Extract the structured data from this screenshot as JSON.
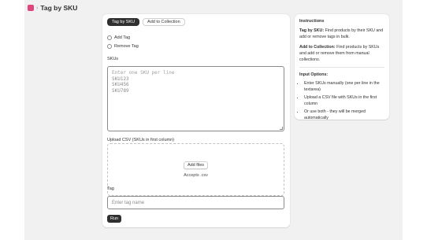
{
  "header": {
    "logo_icon": "app-logo-icon",
    "separator": "›",
    "title": "Tag by SKU",
    "logo_color": "#e0457b"
  },
  "tabs": [
    {
      "label": "Tag by SKU",
      "active": true
    },
    {
      "label": "Add to Collection",
      "active": false
    }
  ],
  "action_options": [
    {
      "label": "Add Tag",
      "selected": false
    },
    {
      "label": "Remove Tag",
      "selected": false
    }
  ],
  "skus": {
    "label": "SKUs",
    "placeholder": "Enter one SKU per line",
    "lines": [
      "SKU123",
      "SKU456",
      "SKU789"
    ]
  },
  "upload": {
    "label": "Upload CSV (SKUs in first column)",
    "button_label": "Add files",
    "accepts_text": "Accepts .csv"
  },
  "tag": {
    "label": "Tag",
    "placeholder": "Enter tag name"
  },
  "run_button": "Run",
  "instructions": {
    "title": "Instructions",
    "tag_by_sku_title": "Tag by SKU:",
    "tag_by_sku_text": " Find products by their SKU and add or remove tags in bulk.",
    "add_to_collection_title": "Add to Collection:",
    "add_to_collection_text": " Find products by SKUs and add or remove them from manual collections.",
    "input_options_title": "Input Options:",
    "input_options": [
      "Enter SKUs manually (one per line in the textarea)",
      "Upload a CSV file with SKUs in the first column",
      "Or use both - they will be merged automatically"
    ]
  },
  "colors": {
    "primary": "#303030",
    "background": "#f1f1f1",
    "card": "#ffffff"
  }
}
